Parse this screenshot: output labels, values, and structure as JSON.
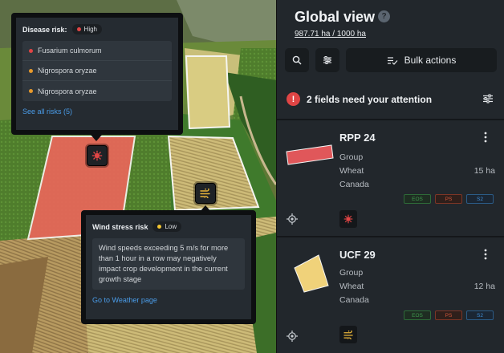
{
  "map": {
    "disease_popup": {
      "title": "Disease risk:",
      "level": "High",
      "level_color": "#e04545",
      "items": [
        {
          "name": "Fusarium culmorum",
          "color": "#e04545"
        },
        {
          "name": "Nigrospora oryzae",
          "color": "#e89a2c"
        },
        {
          "name": "Nigrospora oryzae",
          "color": "#e89a2c"
        }
      ],
      "link": "See all risks (5)",
      "icon": "virus-icon"
    },
    "wind_popup": {
      "title": "Wind stress risk",
      "level": "Low",
      "level_color": "#f2c531",
      "text": "Wind speeds exceeding 5 m/s for more than 1 hour in a row may negatively impact crop development in the current growth stage",
      "link": "Go to Weather page",
      "icon": "wind-icon"
    },
    "colors": {
      "field_red": "#e8675a",
      "field_yellow": "#f0d27a"
    }
  },
  "panel": {
    "title": "Global view",
    "area": "987.71 ha / 1000 ha",
    "toolbar": {
      "search_icon": "search-icon",
      "filter_icon": "sliders-icon",
      "bulk_label": "Bulk actions"
    },
    "attention": {
      "icon": "!",
      "text": "2 fields need your attention"
    },
    "fields": [
      {
        "name": "RPP 24",
        "group": "Group",
        "crop": "Wheat",
        "area": "15 ha",
        "country": "Canada",
        "tags": [
          "EOS",
          "PS",
          "S2"
        ],
        "shape_color": "#e0575a",
        "risk_icon": "virus-icon"
      },
      {
        "name": "UCF 29",
        "group": "Group",
        "crop": "Wheat",
        "area": "12 ha",
        "country": "Canada",
        "tags": [
          "EOS",
          "PS",
          "S2"
        ],
        "shape_color": "#f0d27a",
        "risk_icon": "wind-icon"
      }
    ]
  }
}
